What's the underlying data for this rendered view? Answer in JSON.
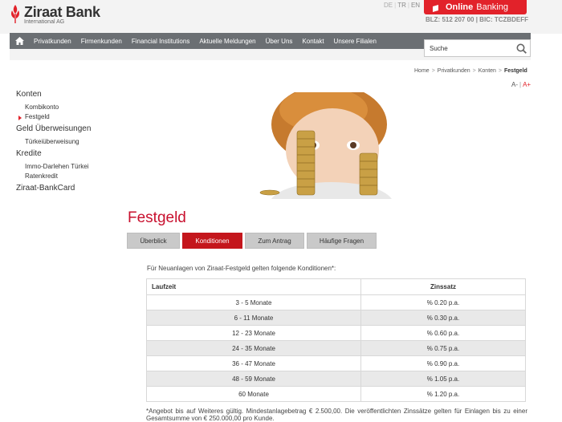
{
  "header": {
    "logo_name": "Ziraat Bank",
    "logo_sub": "International AG",
    "lang": [
      "DE",
      "TR",
      "EN"
    ],
    "online_banking_bold": "Online",
    "online_banking_rest": "Banking",
    "blz": "BLZ: 512 207 00 | BIC: TCZBDEFF"
  },
  "nav": {
    "items": [
      "Privatkunden",
      "Firmenkunden",
      "Financial Institutions",
      "Aktuelle Meldungen",
      "Über Uns",
      "Kontakt",
      "Unsere Filialen"
    ],
    "search_placeholder": "Suche"
  },
  "breadcrumb": [
    "Home",
    "Privatkunden",
    "Konten",
    "Festgeld"
  ],
  "fontsize": {
    "smaller": "A-",
    "larger": "A+"
  },
  "sidebar": {
    "groups": [
      {
        "label": "Konten",
        "items": [
          "Kombikonto",
          "Festgeld"
        ]
      },
      {
        "label": "Geld Überweisungen",
        "items": [
          "Türkeiüberweisung"
        ]
      },
      {
        "label": "Kredite",
        "items": [
          "Immo-Darlehen Türkei",
          "Ratenkredit"
        ]
      },
      {
        "label": "Ziraat-BankCard",
        "items": []
      }
    ],
    "active": "Festgeld"
  },
  "page": {
    "title": "Festgeld",
    "tabs": [
      "Überblick",
      "Konditionen",
      "Zum Antrag",
      "Häufige Fragen"
    ],
    "active_tab": "Konditionen",
    "intro": "Für Neuanlagen von Ziraat-Festgeld gelten folgende Konditionen*:",
    "table": {
      "headers": [
        "Laufzeit",
        "Zinssatz"
      ],
      "rows": [
        [
          "3 - 5 Monate",
          "% 0.20 p.a."
        ],
        [
          "6 - 11 Monate",
          "% 0.30 p.a."
        ],
        [
          "12 - 23 Monate",
          "% 0.60 p.a."
        ],
        [
          "24 - 35 Monate",
          "% 0.75 p.a."
        ],
        [
          "36 - 47 Monate",
          "% 0.90 p.a."
        ],
        [
          "48 - 59 Monate",
          "% 1.05 p.a."
        ],
        [
          "60 Monate",
          "% 1.20 p.a."
        ]
      ]
    },
    "footnote": "*Angebot bis auf Weiteres gültig. Mindestanlagebetrag € 2.500,00. Die veröffentlichten Zinssätze gelten für Einlagen bis zu einer Gesamtsumme von € 250.000,00 pro Kunde."
  },
  "colors": {
    "brand_red": "#e2222a",
    "nav_gray": "#6b6f73",
    "title_red": "#c8102e"
  }
}
